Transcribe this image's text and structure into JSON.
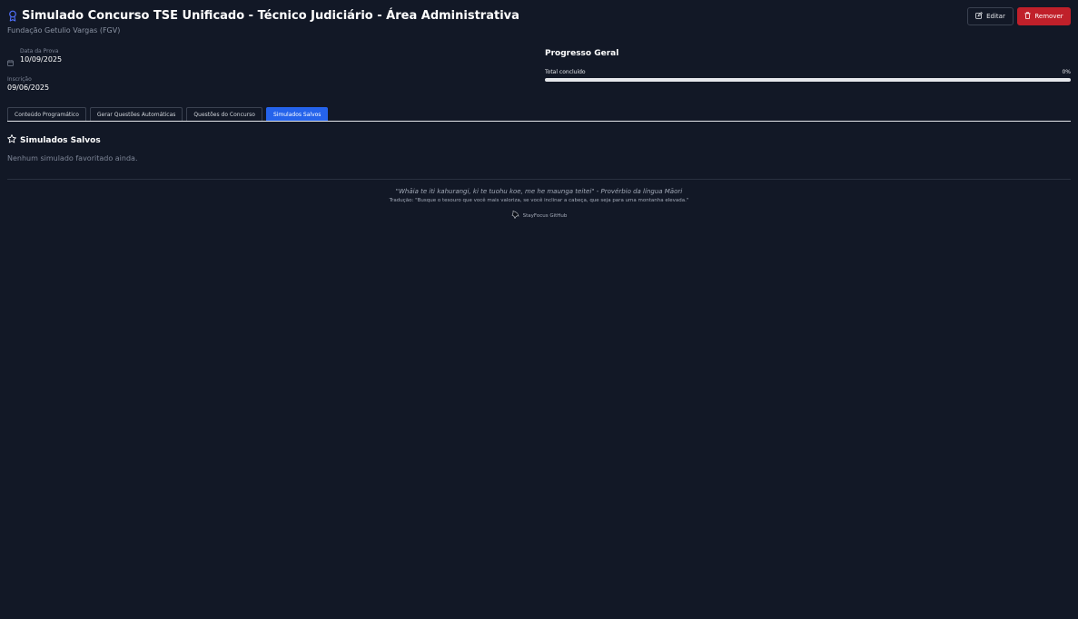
{
  "header": {
    "title": "Simulado Concurso TSE Unificado - Técnico Judiciário - Área Administrativa",
    "subtitle": "Fundação Getulio Vargas (FGV)",
    "edit_label": "Editar",
    "remove_label": "Remover"
  },
  "info": {
    "exam_date_label": "Data da Prova",
    "exam_date_value": "10/09/2025",
    "registration_label": "Inscrição",
    "registration_value": "09/06/2025"
  },
  "progress": {
    "title": "Progresso Geral",
    "total_label": "Total concluído",
    "percent_label": "0%",
    "value": 0
  },
  "tabs": [
    {
      "label": "Conteúdo Programático"
    },
    {
      "label": "Gerar Questões Automáticas"
    },
    {
      "label": "Questões do Concurso"
    },
    {
      "label": "Simulados Salvos",
      "active": true
    }
  ],
  "saved": {
    "title": "Simulados Salvos",
    "empty_message": "Nenhum simulado favoritado ainda."
  },
  "footer": {
    "quote": "\"Whāia te iti kahurangi, ki te tuohu koe, me he maunga teitei\" - Provérbio da língua Māori",
    "translation": "Tradução: \"Busque o tesouro que você mais valoriza, se você inclinar a cabeça, que seja para uma montanha elevada.\"",
    "link_label": "StayFocus GitHub"
  },
  "colors": {
    "background": "#121826",
    "accent": "#2563eb",
    "danger": "#c0202a",
    "award_icon": "#4f6ef7"
  }
}
